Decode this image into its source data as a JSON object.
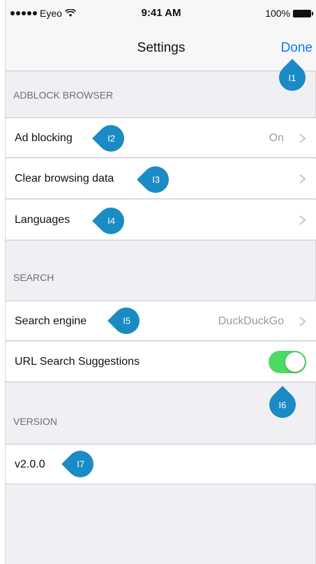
{
  "status_bar": {
    "carrier": "Eyeo",
    "time": "9:41 AM",
    "battery": "100%"
  },
  "nav": {
    "title": "Settings",
    "done_label": "Done"
  },
  "sections": {
    "adblock": {
      "header": "ADBLOCK BROWSER",
      "items": [
        {
          "label": "Ad blocking",
          "detail": "On"
        },
        {
          "label": "Clear browsing data"
        },
        {
          "label": "Languages"
        }
      ]
    },
    "search": {
      "header": "SEARCH",
      "items": [
        {
          "label": "Search engine",
          "detail": "DuckDuckGo"
        },
        {
          "label": "URL Search Suggestions",
          "toggle_on": true
        }
      ]
    },
    "version": {
      "header": "VERSION",
      "items": [
        {
          "label": "v2.0.0"
        }
      ]
    }
  },
  "callouts": [
    "I1",
    "I2",
    "I3",
    "I4",
    "I5",
    "I6",
    "I7"
  ],
  "colors": {
    "accent": "#0a7aff",
    "toggle_on": "#4cd964",
    "callout": "#1a8bc4",
    "background": "#efeff4"
  }
}
